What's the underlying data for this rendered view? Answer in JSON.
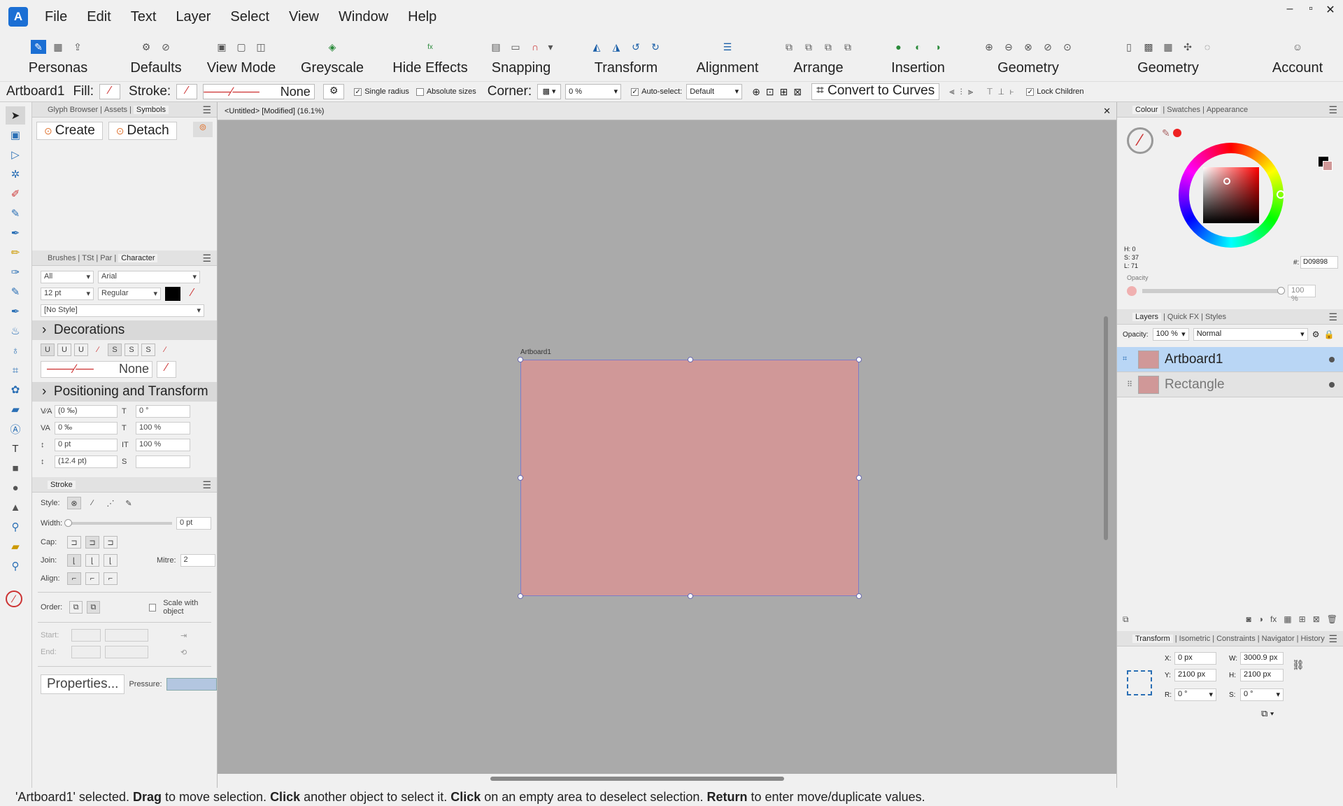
{
  "menubar": {
    "logo": "A",
    "items": [
      "File",
      "Edit",
      "Text",
      "Layer",
      "Select",
      "View",
      "Window",
      "Help"
    ],
    "window_controls": [
      "–",
      "▫",
      "▣",
      "✕"
    ]
  },
  "toolbar": {
    "groups": [
      {
        "label": "Personas",
        "icon": "personas-icon"
      },
      {
        "label": "Defaults",
        "icon": "defaults-icon"
      },
      {
        "label": "View Mode",
        "icon": "view-mode-icon"
      },
      {
        "label": "Greyscale",
        "icon": "greyscale-icon"
      },
      {
        "label": "Hide Effects",
        "icon": "hide-effects-icon"
      },
      {
        "label": "Snapping",
        "icon": "snapping-icon"
      },
      {
        "label": "Transform",
        "icon": "transform-icon"
      },
      {
        "label": "Alignment",
        "icon": "alignment-icon"
      },
      {
        "label": "Arrange",
        "icon": "arrange-icon"
      },
      {
        "label": "Insertion",
        "icon": "insertion-icon"
      },
      {
        "label": "Geometry",
        "icon": "geometry-icon"
      },
      {
        "label": "Geometry",
        "icon": "geometry-2-icon"
      },
      {
        "label": "Account",
        "icon": "account-icon"
      }
    ]
  },
  "context": {
    "selection": "Artboard1",
    "fill_label": "Fill:",
    "stroke_label": "Stroke:",
    "stroke_style": "None",
    "single_radius": "Single radius",
    "absolute_sizes": "Absolute sizes",
    "corner_label": "Corner:",
    "corner_value": "0 %",
    "auto_select_label": "Auto-select:",
    "auto_select_value": "Default",
    "convert": "Convert to Curves",
    "lock_children": "Lock Children"
  },
  "symbols_panel": {
    "tabs": [
      "Glyph Browser",
      "Assets",
      "Symbols"
    ],
    "create": "Create",
    "detach": "Detach"
  },
  "character_panel": {
    "tabs": [
      "Brushes",
      "TSt",
      "Par",
      "Character"
    ],
    "scope": "All",
    "font": "Arial",
    "size": "12 pt",
    "weight": "Regular",
    "style": "[No Style]",
    "decorations": "Decorations",
    "deco_line": "None",
    "positioning": "Positioning and Transform",
    "fields": [
      "(0 ‰)",
      "0 °",
      "0 ‰",
      "100 %",
      "0 pt",
      "100 %",
      "(12.4 pt)",
      ""
    ]
  },
  "stroke_panel": {
    "tab": "Stroke",
    "style_label": "Style:",
    "width_label": "Width:",
    "width_value": "0 pt",
    "cap_label": "Cap:",
    "join_label": "Join:",
    "mitre_label": "Mitre:",
    "mitre_value": "2",
    "align_label": "Align:",
    "order_label": "Order:",
    "scale_label": "Scale with object",
    "start_label": "Start:",
    "end_label": "End:",
    "properties": "Properties...",
    "pressure": "Pressure:"
  },
  "document": {
    "tab": "<Untitled> [Modified] (16.1%)",
    "artboard_label": "Artboard1",
    "artboard_color": "#d09898"
  },
  "colour_panel": {
    "tabs": [
      "Colour",
      "Swatches",
      "Appearance"
    ],
    "h": "H: 0",
    "s": "S: 37",
    "l": "L: 71",
    "opacity_label": "Opacity",
    "opacity_value": "100 %",
    "hex_label": "#:",
    "hex": "D09898"
  },
  "layers_panel": {
    "tabs": [
      "Layers",
      "Quick FX",
      "Styles"
    ],
    "opacity_label": "Opacity:",
    "opacity_value": "100 %",
    "blend": "Normal",
    "layers": [
      "Artboard1",
      "Rectangle"
    ]
  },
  "transform_panel": {
    "tabs": [
      "Transform",
      "Isometric",
      "Constraints",
      "Navigator",
      "History"
    ],
    "x_label": "X:",
    "x": "0 px",
    "y_label": "Y:",
    "y": "2100 px",
    "w_label": "W:",
    "w": "3000.9 px",
    "h_label": "H:",
    "h": "2100 px",
    "r_label": "R:",
    "r": "0 °",
    "s_label": "S:",
    "s": "0 °"
  },
  "status": {
    "p1": "'Artboard1' selected. ",
    "b1": "Drag",
    "p2": " to move selection. ",
    "b2": "Click",
    "p3": " another object to select it. ",
    "b3": "Click",
    "p4": " on an empty area to deselect selection. ",
    "b4": "Return",
    "p5": " to enter move/duplicate values."
  }
}
